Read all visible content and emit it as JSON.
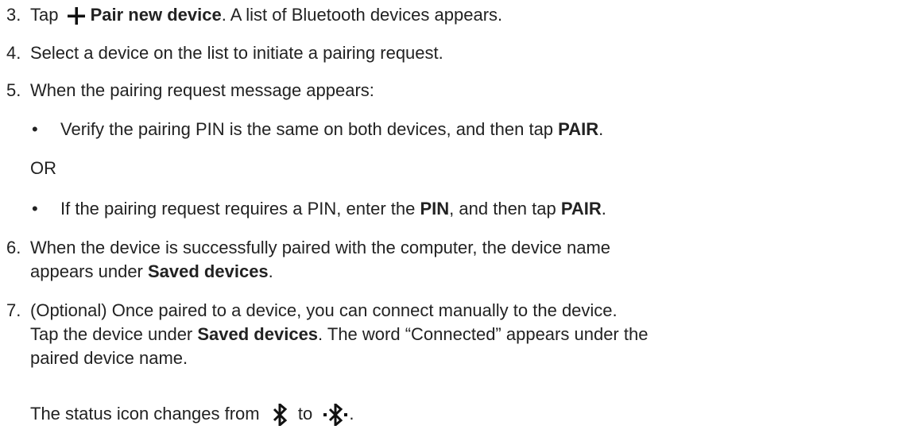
{
  "steps": [
    {
      "number": "3.",
      "pre": "Tap",
      "bold": "Pair new device",
      "post": ". A list of Bluetooth devices appears."
    },
    {
      "number": "4.",
      "text": "Select a device on the list to initiate a pairing request."
    },
    {
      "number": "5.",
      "text": "When the pairing request message appears:",
      "bullets": [
        {
          "pre": "Verify the pairing PIN is the same on both devices, and then tap ",
          "bold": "PAIR",
          "post": "."
        },
        {
          "pre": "If the pairing request requires a PIN, enter the ",
          "bold1": "PIN",
          "mid": ", and then tap ",
          "bold2": "PAIR",
          "post": "."
        }
      ],
      "or_label": "OR"
    },
    {
      "number": "6.",
      "line1": "When the device is successfully paired with the computer, the device name",
      "line2_pre": "appears under ",
      "line2_bold": "Saved devices",
      "line2_post": "."
    },
    {
      "number": "7.",
      "line1": "(Optional) Once paired to a device, you can connect manually to the device.",
      "line2_pre": "Tap the device under ",
      "line2_bold": "Saved devices",
      "line2_post": ". The word “Connected” appears under the",
      "line3": "paired device name."
    }
  ],
  "status_line": {
    "pre": "The status icon changes from",
    "mid": "to",
    "post": "."
  },
  "icons": {
    "add": "plus-icon",
    "bt_off": "bluetooth-icon",
    "bt_connected": "bluetooth-connected-icon"
  }
}
